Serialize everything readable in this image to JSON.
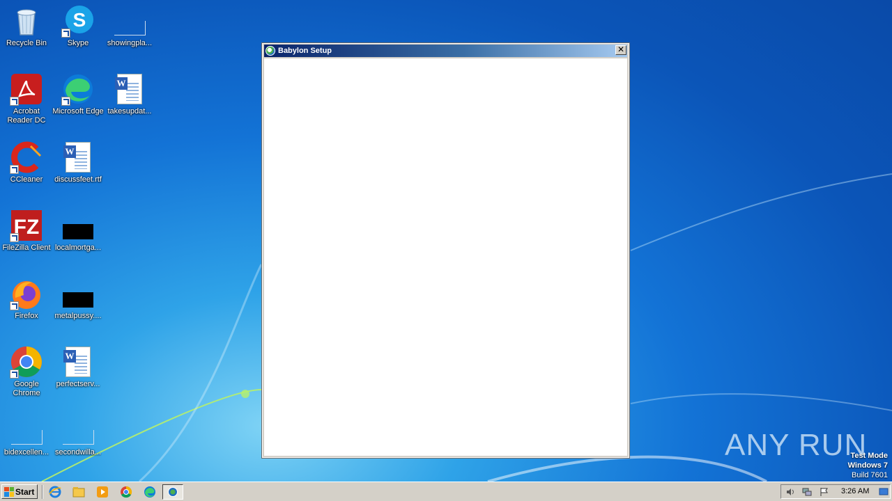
{
  "desktop": {
    "icons": [
      {
        "label": "Recycle Bin"
      },
      {
        "label": "Skype"
      },
      {
        "label": "showingpla..."
      },
      {
        "label": "Acrobat Reader DC"
      },
      {
        "label": "Microsoft Edge"
      },
      {
        "label": "takesupdat..."
      },
      {
        "label": "CCleaner"
      },
      {
        "label": "discussfeet.rtf"
      },
      {
        "label": "FileZilla Client"
      },
      {
        "label": "localmortga..."
      },
      {
        "label": "Firefox"
      },
      {
        "label": "metalpussy...."
      },
      {
        "label": "Google Chrome"
      },
      {
        "label": "perfectserv..."
      },
      {
        "label": "bidexcellen..."
      },
      {
        "label": "secondwilla..."
      }
    ]
  },
  "window": {
    "title": "Babylon Setup",
    "close_label": "✕"
  },
  "watermark": {
    "text": "ANY RUN"
  },
  "test_mode": {
    "line1": "Test Mode",
    "line2": "Windows 7",
    "line3": "Build 7601"
  },
  "taskbar": {
    "start_label": "Start",
    "clock": "3:26 AM"
  },
  "colors": {
    "desktop_blue": "#1373d6",
    "titlebar_start": "#0a246a",
    "titlebar_end": "#a6caf0",
    "taskbar": "#d4d0c8"
  }
}
